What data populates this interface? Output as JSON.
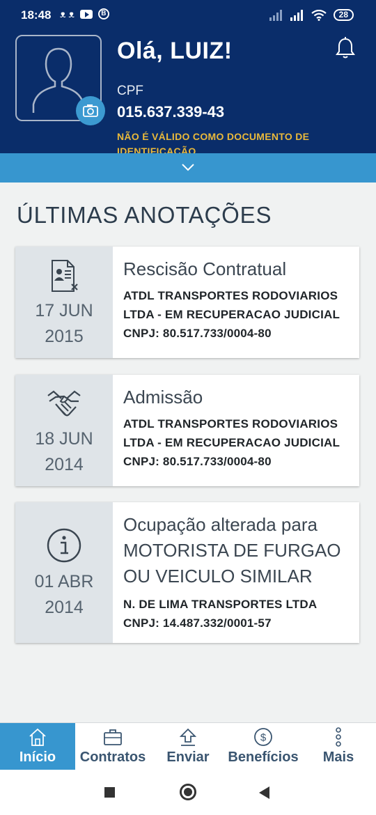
{
  "status_bar": {
    "time": "18:48",
    "notif_glyphs": "ᴥ ᴥ",
    "battery": "28"
  },
  "header": {
    "greeting": "Olá, LUIZ!",
    "cpf_label": "CPF",
    "cpf_value": "015.637.339-43",
    "warning": "NÃO É VÁLIDO COMO DOCUMENTO DE IDENTIFICAÇÃO"
  },
  "section_title": "ÚLTIMAS ANOTAÇÕES",
  "annotations": [
    {
      "icon": "document-x-icon",
      "date_day": "17 JUN",
      "date_year": "2015",
      "title_lines": [
        "Rescisão Contratual"
      ],
      "company_lines": [
        "ATDL TRANSPORTES RODOVIARIOS",
        "LTDA - EM RECUPERACAO JUDICIAL",
        "CNPJ: 80.517.733/0004-80"
      ]
    },
    {
      "icon": "handshake-icon",
      "date_day": "18 JUN",
      "date_year": "2014",
      "title_lines": [
        "Admissão"
      ],
      "company_lines": [
        "ATDL TRANSPORTES RODOVIARIOS",
        "LTDA - EM RECUPERACAO JUDICIAL",
        "CNPJ: 80.517.733/0004-80"
      ]
    },
    {
      "icon": "info-icon",
      "date_day": "01 ABR",
      "date_year": "2014",
      "title_lines": [
        "Ocupação alterada para",
        "MOTORISTA DE FURGAO",
        "OU VEICULO SIMILAR"
      ],
      "company_lines": [
        "N. DE LIMA TRANSPORTES LTDA",
        "CNPJ: 14.487.332/0001-57"
      ]
    }
  ],
  "bottom_nav": {
    "items": [
      {
        "label": "Início",
        "icon": "home-icon",
        "active": true
      },
      {
        "label": "Contratos",
        "icon": "briefcase-icon",
        "active": false
      },
      {
        "label": "Enviar",
        "icon": "upload-icon",
        "active": false
      },
      {
        "label": "Benefícios",
        "icon": "dollar-icon",
        "active": false
      },
      {
        "label": "Mais",
        "icon": "more-icon",
        "active": false
      }
    ]
  },
  "colors": {
    "header_bg": "#0a2d6a",
    "accent": "#3796cf",
    "warning": "#e9b93b"
  }
}
